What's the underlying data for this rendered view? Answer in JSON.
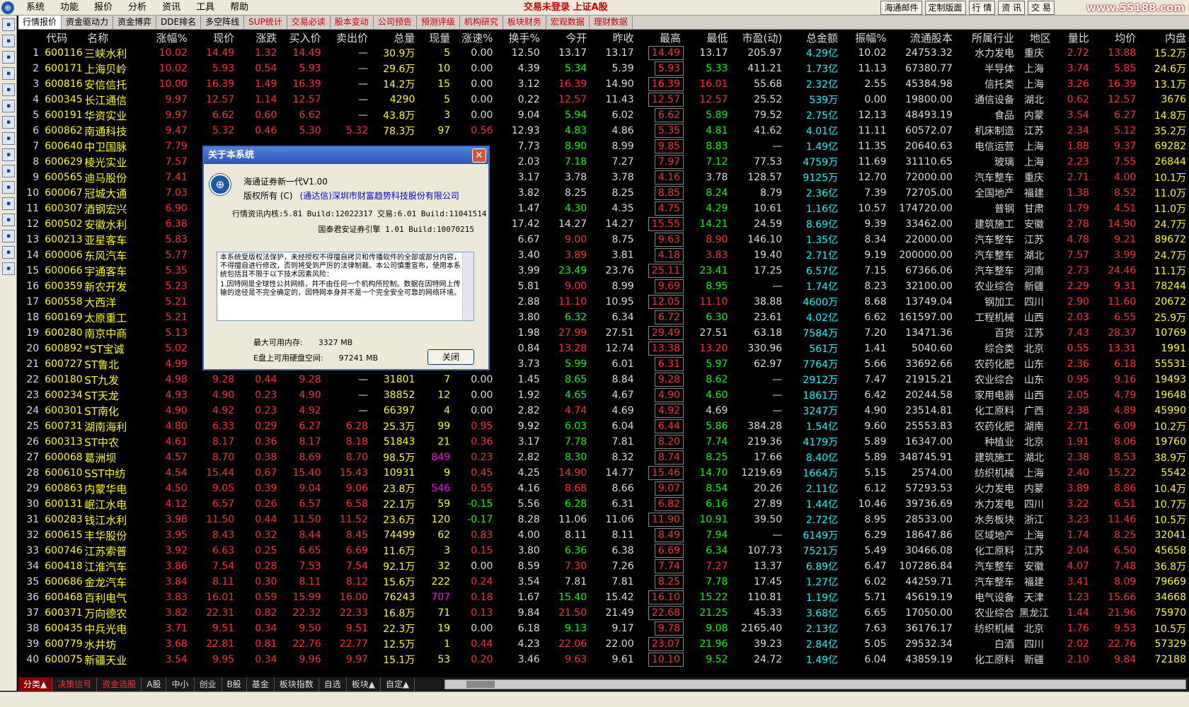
{
  "menubar": {
    "logo": "⊕",
    "items": [
      "系统",
      "功能",
      "报价",
      "分析",
      "资讯",
      "工具",
      "帮助"
    ],
    "title": "交易未登录  上证A股",
    "buttons": [
      "海通邮件",
      "定制版面",
      "行 情",
      "资 讯",
      "交 易"
    ],
    "watermark": "www.55188.com"
  },
  "tabs": [
    "行情报价",
    "资金驱动力",
    "资金博弈",
    "DDE排名",
    "多空阵线",
    "SUP统计",
    "交易必读",
    "股本变动",
    "公司预告",
    "预测评级",
    "机构研究",
    "板块财务",
    "宏观数据",
    "理财数据"
  ],
  "sidebar_icons": [
    "icon-1",
    "icon-2",
    "icon-3",
    "icon-4",
    "icon-5",
    "icon-6",
    "icon-7",
    "icon-8",
    "icon-9",
    "icon-10",
    "icon-11",
    "icon-12",
    "icon-13",
    "icon-14",
    "icon-15",
    "icon-16"
  ],
  "columns": [
    "",
    "代码",
    "名称",
    "涨幅%",
    "现价",
    "涨跌",
    "买入价",
    "卖出价",
    "总量",
    "现量",
    "涨速%",
    "换手%",
    "今开",
    "昨收",
    "最高",
    "最低",
    "市盈(动)",
    "总金额",
    "振幅%",
    "流通股本",
    "所属行业",
    "地区",
    "量比",
    "均价",
    "内盘"
  ],
  "rows": [
    [
      "1",
      "600116",
      "三峡水利",
      "10.02",
      "14.49",
      "1.32",
      "14.49",
      "—",
      "30.9万",
      "5",
      "0.00",
      "12.50",
      "13.17",
      "13.17",
      "14.49",
      "13.17",
      "205.97",
      "4.29亿",
      "10.02",
      "24753.32",
      "水力发电",
      "重庆",
      "2.72",
      "13.88",
      "15.2万"
    ],
    [
      "2",
      "600171",
      "上海贝岭",
      "10.02",
      "5.93",
      "0.54",
      "5.93",
      "—",
      "29.6万",
      "10",
      "0.00",
      "4.39",
      "5.34",
      "5.39",
      "5.93",
      "5.33",
      "411.21",
      "1.73亿",
      "11.13",
      "67380.77",
      "半导体",
      "上海",
      "3.74",
      "5.85",
      "24.6万"
    ],
    [
      "3",
      "600816",
      "安信信托",
      "10.00",
      "16.39",
      "1.49",
      "16.39",
      "—",
      "14.2万",
      "15",
      "0.00",
      "3.12",
      "16.39",
      "14.90",
      "16.39",
      "16.01",
      "55.68",
      "2.32亿",
      "2.55",
      "45384.98",
      "信托类",
      "上海",
      "3.26",
      "16.39",
      "13.1万"
    ],
    [
      "4",
      "600345",
      "长江通信",
      "9.97",
      "12.57",
      "1.14",
      "12.57",
      "—",
      "4290",
      "5",
      "0.00",
      "0.22",
      "12.57",
      "11.43",
      "12.57",
      "12.57",
      "25.52",
      "539万",
      "0.00",
      "19800.00",
      "通信设备",
      "湖北",
      "0.62",
      "12.57",
      "3676"
    ],
    [
      "5",
      "600191",
      "华资实业",
      "9.97",
      "6.62",
      "0.60",
      "6.62",
      "—",
      "43.8万",
      "3",
      "0.00",
      "9.04",
      "5.94",
      "6.02",
      "6.62",
      "5.89",
      "79.52",
      "2.75亿",
      "12.13",
      "48493.19",
      "食品",
      "内蒙",
      "3.54",
      "6.27",
      "14.8万"
    ],
    [
      "6",
      "600862",
      "南通科技",
      "9.47",
      "5.32",
      "0.46",
      "5.30",
      "5.32",
      "78.3万",
      "97",
      "0.56",
      "12.93",
      "4.83",
      "4.86",
      "5.35",
      "4.81",
      "41.62",
      "4.01亿",
      "11.11",
      "60572.07",
      "机床制造",
      "江苏",
      "2.34",
      "5.12",
      "35.2万"
    ],
    [
      "7",
      "600640",
      "中卫国脉",
      "7.79",
      "",
      "",
      "",
      "",
      "",
      "",
      "",
      "7.73",
      "8.90",
      "8.99",
      "9.85",
      "8.83",
      "—",
      "1.49亿",
      "11.35",
      "20640.63",
      "电信运营",
      "上海",
      "1.88",
      "9.37",
      "69282"
    ],
    [
      "8",
      "600629",
      "棱光实业",
      "7.57",
      "",
      "",
      "",
      "",
      "",
      "",
      "",
      "2.03",
      "7.18",
      "7.27",
      "7.97",
      "7.12",
      "77.53",
      "4759万",
      "11.69",
      "31110.65",
      "玻璃",
      "上海",
      "2.23",
      "7.55",
      "26844"
    ],
    [
      "9",
      "600565",
      "迪马股份",
      "7.41",
      "",
      "",
      "",
      "",
      "",
      "",
      "",
      "3.17",
      "3.78",
      "3.78",
      "4.16",
      "3.78",
      "128.57",
      "9125万",
      "12.70",
      "72000.00",
      "汽车整车",
      "重庆",
      "2.71",
      "4.00",
      "10.1万"
    ],
    [
      "10",
      "600067",
      "冠城大通",
      "7.03",
      "",
      "",
      "",
      "",
      "",
      "",
      "",
      "3.82",
      "8.25",
      "8.25",
      "8.85",
      "8.24",
      "8.79",
      "2.36亿",
      "7.39",
      "72705.00",
      "全国地产",
      "福建",
      "1.38",
      "8.52",
      "11.0万"
    ],
    [
      "11",
      "600307",
      "酒钢宏兴",
      "6.90",
      "",
      "",
      "",
      "",
      "",
      "",
      "",
      "1.47",
      "4.30",
      "4.35",
      "4.75",
      "4.29",
      "10.61",
      "1.16亿",
      "10.57",
      "174720.00",
      "普钢",
      "甘肃",
      "1.79",
      "4.51",
      "11.0万"
    ],
    [
      "12",
      "600502",
      "安徽水利",
      "6.38",
      "",
      "",
      "",
      "",
      "",
      "",
      "",
      "17.42",
      "14.27",
      "14.27",
      "15.55",
      "14.21",
      "24.59",
      "8.69亿",
      "9.39",
      "33462.00",
      "建筑施工",
      "安徽",
      "2.78",
      "14.90",
      "24.7万"
    ],
    [
      "13",
      "600213",
      "亚星客车",
      "5.83",
      "",
      "",
      "",
      "",
      "",
      "",
      "",
      "6.67",
      "9.00",
      "8.75",
      "9.63",
      "8.90",
      "146.10",
      "1.35亿",
      "8.34",
      "22000.00",
      "汽车整车",
      "江苏",
      "4.78",
      "9.21",
      "89672"
    ],
    [
      "14",
      "600006",
      "东风汽车",
      "5.77",
      "",
      "",
      "",
      "",
      "",
      "",
      "",
      "3.40",
      "3.89",
      "3.81",
      "4.18",
      "3.83",
      "19.40",
      "2.71亿",
      "9.19",
      "200000.00",
      "汽车整车",
      "湖北",
      "7.57",
      "3.99",
      "24.7万"
    ],
    [
      "15",
      "600066",
      "宇通客车",
      "5.35",
      "",
      "",
      "",
      "",
      "",
      "",
      "",
      "3.99",
      "23.49",
      "23.76",
      "25.11",
      "23.41",
      "17.25",
      "6.57亿",
      "7.15",
      "67366.06",
      "汽车整车",
      "河南",
      "2.73",
      "24.46",
      "11.1万"
    ],
    [
      "16",
      "600359",
      "新农开发",
      "5.23",
      "",
      "",
      "",
      "",
      "",
      "",
      "",
      "5.81",
      "9.00",
      "8.99",
      "9.69",
      "8.95",
      "—",
      "1.74亿",
      "8.23",
      "32100.00",
      "农业综合",
      "新疆",
      "2.29",
      "9.31",
      "78244"
    ],
    [
      "17",
      "600558",
      "大西洋",
      "5.21",
      "",
      "",
      "",
      "",
      "",
      "",
      "",
      "2.88",
      "11.10",
      "10.95",
      "12.05",
      "11.10",
      "38.88",
      "4600万",
      "8.68",
      "13749.04",
      "钢加工",
      "四川",
      "2.90",
      "11.60",
      "20672"
    ],
    [
      "18",
      "600169",
      "太原重工",
      "5.21",
      "",
      "",
      "",
      "",
      "",
      "",
      "",
      "3.80",
      "6.32",
      "6.34",
      "6.72",
      "6.30",
      "23.61",
      "4.02亿",
      "6.62",
      "161597.00",
      "工程机械",
      "山西",
      "2.03",
      "6.55",
      "25.9万"
    ],
    [
      "19",
      "600280",
      "南京中商",
      "5.13",
      "",
      "",
      "",
      "",
      "",
      "",
      "",
      "1.98",
      "27.99",
      "27.51",
      "29.49",
      "27.51",
      "63.18",
      "7584万",
      "7.20",
      "13471.36",
      "百货",
      "江苏",
      "7.43",
      "28.37",
      "10769"
    ],
    [
      "20",
      "600892",
      "*ST宝诚",
      "5.02",
      "",
      "",
      "",
      "",
      "",
      "",
      "",
      "0.84",
      "13.28",
      "12.74",
      "13.38",
      "13.20",
      "330.96",
      "561万",
      "1.41",
      "5040.60",
      "综合类",
      "北京",
      "0.55",
      "13.31",
      "1991"
    ],
    [
      "21",
      "600727",
      "ST鲁北",
      "4.99",
      "",
      "",
      "",
      "",
      "",
      "",
      "",
      "3.73",
      "5.99",
      "6.01",
      "6.31",
      "5.97",
      "62.97",
      "7764万",
      "5.66",
      "33692.66",
      "农药化肥",
      "山东",
      "2.36",
      "6.18",
      "55531"
    ],
    [
      "22",
      "600180",
      "ST九发",
      "4.98",
      "9.28",
      "0.44",
      "9.28",
      "—",
      "31801",
      "7",
      "0.00",
      "1.45",
      "8.65",
      "8.84",
      "9.28",
      "8.62",
      "—",
      "2912万",
      "7.47",
      "21915.21",
      "农业综合",
      "山东",
      "0.95",
      "9.16",
      "19493"
    ],
    [
      "23",
      "600234",
      "ST天龙",
      "4.93",
      "4.90",
      "0.23",
      "4.90",
      "—",
      "38852",
      "12",
      "0.00",
      "1.92",
      "4.65",
      "4.67",
      "4.90",
      "4.60",
      "—",
      "1861万",
      "6.42",
      "20244.58",
      "家用电器",
      "山西",
      "2.05",
      "4.79",
      "19648"
    ],
    [
      "24",
      "600301",
      "ST南化",
      "4.90",
      "4.92",
      "0.23",
      "4.92",
      "—",
      "66397",
      "4",
      "0.00",
      "2.82",
      "4.74",
      "4.69",
      "4.92",
      "4.69",
      "—",
      "3247万",
      "4.90",
      "23514.81",
      "化工原料",
      "广西",
      "2.38",
      "4.89",
      "45990"
    ],
    [
      "25",
      "600731",
      "湖南海利",
      "4.80",
      "6.33",
      "0.29",
      "6.27",
      "6.28",
      "25.3万",
      "99",
      "0.95",
      "9.92",
      "6.03",
      "6.04",
      "6.44",
      "5.86",
      "384.28",
      "1.54亿",
      "9.60",
      "25553.83",
      "农药化肥",
      "湖南",
      "2.71",
      "6.09",
      "10.2万"
    ],
    [
      "26",
      "600313",
      "ST中农",
      "4.61",
      "8.17",
      "0.36",
      "8.17",
      "8.18",
      "51843",
      "21",
      "0.36",
      "3.17",
      "7.78",
      "7.81",
      "8.20",
      "7.74",
      "219.36",
      "4179万",
      "5.89",
      "16347.00",
      "种植业",
      "北京",
      "1.91",
      "8.06",
      "19760"
    ],
    [
      "27",
      "600068",
      "葛洲坝",
      "4.57",
      "8.70",
      "0.38",
      "8.69",
      "8.70",
      "98.5万",
      "849",
      "0.23",
      "2.82",
      "8.30",
      "8.32",
      "8.74",
      "8.25",
      "17.66",
      "8.40亿",
      "5.89",
      "348745.91",
      "建筑施工",
      "湖北",
      "2.38",
      "8.53",
      "38.9万"
    ],
    [
      "28",
      "600610",
      "SST中纺",
      "4.54",
      "15.44",
      "0.67",
      "15.40",
      "15.43",
      "10931",
      "9",
      "0.45",
      "4.25",
      "14.90",
      "14.77",
      "15.46",
      "14.70",
      "1219.69",
      "1664万",
      "5.15",
      "2574.00",
      "纺织机械",
      "上海",
      "2.40",
      "15.22",
      "5542"
    ],
    [
      "29",
      "600863",
      "内蒙华电",
      "4.50",
      "9.05",
      "0.39",
      "9.04",
      "9.06",
      "23.8万",
      "546",
      "0.55",
      "4.16",
      "8.68",
      "8.66",
      "9.07",
      "8.54",
      "20.26",
      "2.11亿",
      "6.12",
      "57293.53",
      "火力发电",
      "内蒙",
      "3.89",
      "8.86",
      "10.4万"
    ],
    [
      "30",
      "600131",
      "岷江水电",
      "4.12",
      "6.57",
      "0.26",
      "6.57",
      "6.58",
      "22.1万",
      "59",
      "-0.15",
      "5.56",
      "6.28",
      "6.31",
      "6.82",
      "6.16",
      "27.89",
      "1.44亿",
      "10.46",
      "39736.69",
      "水力发电",
      "四川",
      "3.22",
      "6.51",
      "10.7万"
    ],
    [
      "31",
      "600283",
      "钱江水利",
      "3.98",
      "11.50",
      "0.44",
      "11.50",
      "11.52",
      "23.6万",
      "120",
      "-0.17",
      "8.28",
      "11.06",
      "11.06",
      "11.90",
      "10.91",
      "39.50",
      "2.72亿",
      "8.95",
      "28533.00",
      "水务板块",
      "浙江",
      "3.23",
      "11.46",
      "10.5万"
    ],
    [
      "32",
      "600615",
      "丰华股份",
      "3.95",
      "8.43",
      "0.32",
      "8.44",
      "8.45",
      "74499",
      "62",
      "0.83",
      "4.00",
      "8.11",
      "8.11",
      "8.49",
      "7.94",
      "—",
      "6149万",
      "6.29",
      "18647.86",
      "区域地产",
      "上海",
      "1.74",
      "8.25",
      "32041"
    ],
    [
      "33",
      "600746",
      "江苏索普",
      "3.92",
      "6.63",
      "0.25",
      "6.65",
      "6.69",
      "11.6万",
      "3",
      "0.15",
      "3.80",
      "6.36",
      "6.38",
      "6.69",
      "6.34",
      "107.73",
      "7521万",
      "5.49",
      "30466.08",
      "化工原料",
      "江苏",
      "2.04",
      "6.50",
      "45658"
    ],
    [
      "34",
      "600418",
      "江淮汽车",
      "3.86",
      "7.54",
      "0.28",
      "7.53",
      "7.54",
      "92.1万",
      "32",
      "0.00",
      "8.59",
      "7.30",
      "7.26",
      "7.74",
      "7.27",
      "13.37",
      "6.89亿",
      "6.47",
      "107286.84",
      "汽车整车",
      "安徽",
      "4.07",
      "7.48",
      "36.8万"
    ],
    [
      "35",
      "600686",
      "金龙汽车",
      "3.84",
      "8.11",
      "0.30",
      "8.11",
      "8.12",
      "15.6万",
      "222",
      "0.24",
      "3.54",
      "7.81",
      "7.81",
      "8.25",
      "7.78",
      "17.45",
      "1.27亿",
      "6.02",
      "44259.71",
      "汽车整车",
      "福建",
      "3.41",
      "8.09",
      "79669"
    ],
    [
      "36",
      "600468",
      "百利电气",
      "3.83",
      "16.01",
      "0.59",
      "15.99",
      "16.00",
      "76243",
      "707",
      "0.18",
      "1.67",
      "15.40",
      "15.42",
      "16.10",
      "15.22",
      "110.81",
      "1.19亿",
      "5.71",
      "45619.19",
      "电气设备",
      "天津",
      "1.23",
      "15.66",
      "34668"
    ],
    [
      "37",
      "600371",
      "万向德农",
      "3.82",
      "22.31",
      "0.82",
      "22.32",
      "22.33",
      "16.8万",
      "71",
      "0.13",
      "9.84",
      "21.50",
      "21.49",
      "22.68",
      "21.25",
      "45.33",
      "3.68亿",
      "6.65",
      "17050.00",
      "农业综合",
      "黑龙江",
      "1.44",
      "21.96",
      "75970"
    ],
    [
      "38",
      "600435",
      "中兵光电",
      "3.71",
      "9.51",
      "0.34",
      "9.50",
      "9.51",
      "22.3万",
      "19",
      "0.00",
      "6.18",
      "9.13",
      "9.17",
      "9.78",
      "9.08",
      "2165.40",
      "2.13亿",
      "7.63",
      "36176.17",
      "纺织机械",
      "北京",
      "1.76",
      "9.53",
      "10.5万"
    ],
    [
      "39",
      "600779",
      "水井坊",
      "3.68",
      "22.81",
      "0.81",
      "22.76",
      "22.77",
      "12.5万",
      "1",
      "0.44",
      "4.23",
      "22.06",
      "22.00",
      "23.07",
      "21.96",
      "39.23",
      "2.84亿",
      "5.05",
      "29532.34",
      "白酒",
      "四川",
      "2.02",
      "22.76",
      "57329"
    ],
    [
      "40",
      "600075",
      "新疆天业",
      "3.54",
      "9.95",
      "0.34",
      "9.96",
      "9.97",
      "15.1万",
      "53",
      "0.20",
      "3.46",
      "9.63",
      "9.61",
      "10.10",
      "9.52",
      "24.72",
      "1.49亿",
      "6.04",
      "43859.19",
      "化工原料",
      "新疆",
      "2.10",
      "9.84",
      "72188"
    ]
  ],
  "bottom_tabs": [
    "分类▲",
    "决策信号",
    "资金选股",
    "A股",
    "中小",
    "创业",
    "B股",
    "基金",
    "板块指数",
    "自选",
    "板块▲",
    "自定▲"
  ],
  "dialog": {
    "title": "关于本系统",
    "close": "✕",
    "product": "海通证券新一代V1.00",
    "copyright_label": "版权所有 (C)",
    "copyright_owner": "(通达信)深圳市财富趋势科技股份有限公司",
    "version_line": "行情资讯内核:5.81 Build:12022317 交易:6.01 Build:11041514",
    "engine_line": "国泰君安证券引擎 1.01 Build:10070215",
    "notice_p1": "本系统受版权法保护，未经授权不得擅自拷贝和传播软件的全部或部分内容，不得擅自进行修改，否则将受到严厉的法律制裁。本公司慎重宣布，使用本系统包括且不限于以下技术因素风险：",
    "notice_p2": "1.因特网是全球性公共网络，并不由任何一个机构所控制。数据在因特网上传输的途径是不完全确定的，因特网本身并不是一个完全安全可靠的网络环境。",
    "mem_label": "最大可用内存:",
    "mem_value": "3327 MB",
    "disk_label": "E盘上可用硬盘空间:",
    "disk_value": "97241 MB",
    "ok_label": "关闭"
  }
}
